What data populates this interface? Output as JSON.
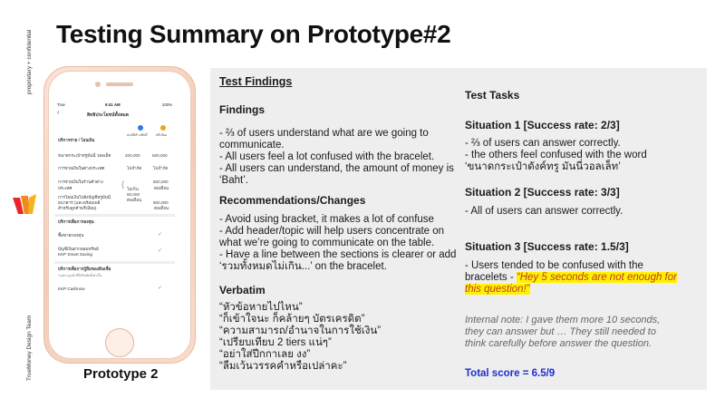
{
  "sidebar": {
    "top_text": "proprietary + confidential",
    "bottom_text": "TrueMoney Design Team"
  },
  "slide": {
    "title": "Testing Summary on Prototype#2",
    "prototype_label": "Prototype 2"
  },
  "phone_screen": {
    "status_left": "True",
    "status_time": "9:41 AM",
    "status_right": "100%",
    "nav_title": "สิทธิประโยชน์ทั้งหมด",
    "col1_label": "สมบัติล้านสิทธิ์",
    "col2_label": "พรีเมียม",
    "section1_title": "บริการจ่าย / โอนเงิน",
    "rows": [
      {
        "label": "ขนาดกระเป๋าทรูมันนี่ วอลเล็ท",
        "v1": "200,000",
        "v2": "500,000"
      },
      {
        "label": "การจ่ายเงินในต่างประเทศ",
        "v1": "ไม่จำกัด",
        "v2": "ไม่จำกัด"
      }
    ],
    "row3_label": "การจ่ายเงินในร้านค้าต่าง",
    "row3_label2": "ประเทศ",
    "row3_v2a": "500,000",
    "row3_v2b": "ต่อเดือน",
    "row4_label": "การโอนเงินไปยังบัญชีทรูมันนี่",
    "row4_label2": "ธนาคาร (และพร้อมเพย์",
    "row4_label3": "สำหรับลูกค้าพรีเมียม)",
    "bracket_v1a": "ไม่เกิน",
    "bracket_v1b": "50,000",
    "bracket_v1c": "ต่อเดือน",
    "row4_v2a": "500,000",
    "row4_v2b": "ต่อเดือน",
    "section2_title": "บริการเพื่อการลงทุน",
    "invest_rows": [
      "ซื้อขายกองทุน",
      "บัญชีเงินฝากออมทรัพย์",
      "KKP Smart Saving"
    ],
    "section3_title": "บริการเพื่อการกู้ยืมของสินเชื่อ",
    "section3_sub": "*เฉพาะลูกค้าที่ได้รับสิทธิ์เท่านั้น",
    "loan_row": "KKP Cashnow"
  },
  "findings": {
    "heading": "Test Findings",
    "findings_title": "Findings",
    "findings_lines": [
      "- ⅔ of users understand what are we going to",
      "communicate.",
      "- All users feel a lot confused with the bracelet.",
      "- All users can understand, the amount of money is",
      "‘Baht’."
    ],
    "rec_title": "Recommendations/Changes",
    "rec_lines": [
      "- Avoid using bracket, it makes a lot of confuse",
      "- Add header/topic will help users concentrate on",
      "what we’re going to communicate on the table.",
      "- Have a line between the sections is clearer or add",
      "‘รวมทั้งหมดไม่เกิน...’ on the bracelet."
    ],
    "verbatim_title": "Verbatim",
    "verbatim_lines": [
      "“หัวข้อหายไปไหน”",
      "“ก็เข้าใจนะ ก็คล้ายๆ บัตรเครดิต”",
      "“ความสามารถ/อำนาจในการใช้เงิน”",
      "“เปรียบเทียบ 2 tiers แน่ๆ”",
      "“อย่าใส่ปีกกาเลย งง”",
      "“ลืมเว้นวรรคคำหรือเปล่าคะ”"
    ]
  },
  "tasks": {
    "heading": "Test Tasks",
    "s1_title": "Situation 1 [Success rate: 2/3]",
    "s1_lines": [
      "- ⅔ of users can answer correctly.",
      "- the others feel confused with the word",
      "‘ขนาดกระเป๋าดังค์ทรู มันนี่วอลเล็ท’"
    ],
    "s2_title": "Situation 2 [Success rate: 3/3]",
    "s2_line": "- All of users can answer correctly.",
    "s3_title": "Situation 3 [Success rate: 1.5/3]",
    "s3_line1": "- Users tended to be confused with the",
    "s3_line2_prefix": "bracelets - ",
    "s3_quote1": "“Hey 5 seconds are not enough for",
    "s3_quote2": "this question!”",
    "note_lines": [
      "Internal note: I gave them more 10 seconds,",
      "they can answer but … They still needed to",
      "think carefully before answer the question."
    ],
    "total": "Total score = 6.5/9"
  },
  "colors": {
    "panel_bg": "#eeeeee",
    "highlight": "#fff200",
    "quote_red": "#c0392b",
    "total_blue": "#1f2fd0",
    "check_green": "#2fb56b"
  }
}
